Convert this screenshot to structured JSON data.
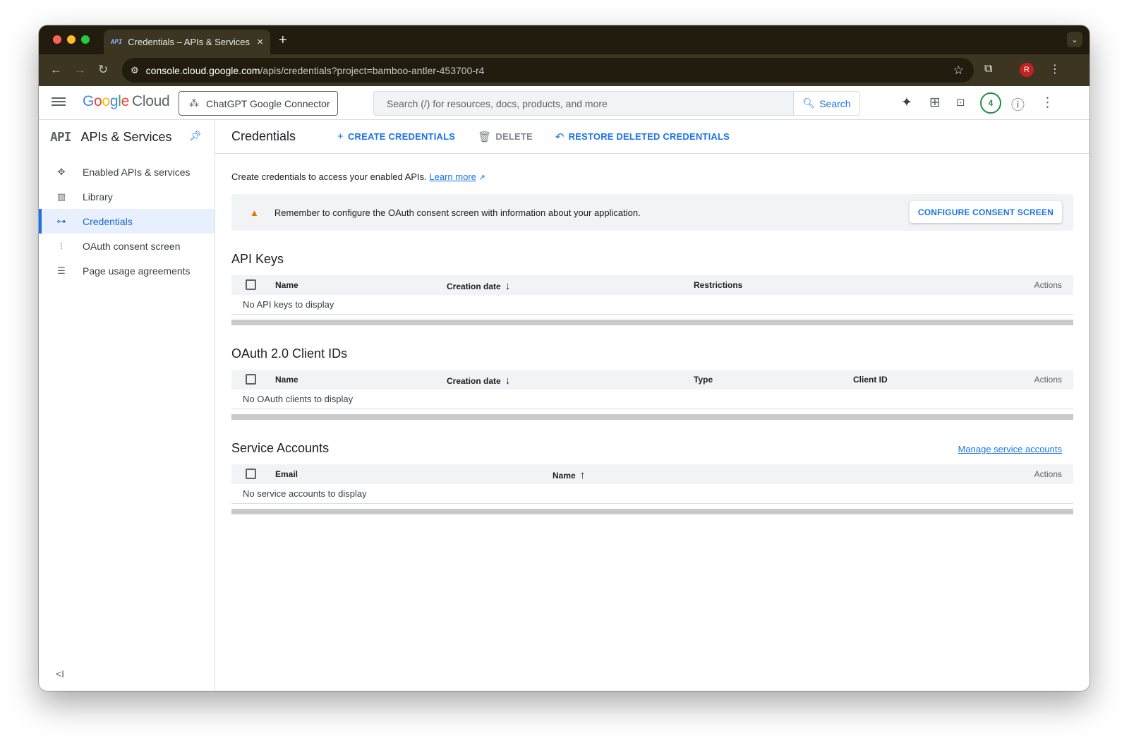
{
  "browser": {
    "tab_favicon": "API",
    "tab_title": "Credentials – APIs & Services",
    "tab_close": "×",
    "new_tab": "+",
    "url_host": "console.cloud.google.com",
    "url_path": "/apis/credentials?project=bamboo-antler-453700-r4",
    "profile_initial": "R"
  },
  "header": {
    "logo_google": [
      "G",
      "o",
      "o",
      "g",
      "l",
      "e"
    ],
    "logo_cloud": "Cloud",
    "project_name": "ChatGPT Google Connector",
    "search_placeholder": "Search (/) for resources, docs, products, and more",
    "search_button": "Search",
    "notification_count": "4"
  },
  "sidebar": {
    "logo": "API",
    "title": "APIs & Services",
    "items": [
      {
        "label": "Enabled APIs & services",
        "icon": "enabled-apis-icon"
      },
      {
        "label": "Library",
        "icon": "library-icon"
      },
      {
        "label": "Credentials",
        "icon": "key-icon",
        "active": true
      },
      {
        "label": "OAuth consent screen",
        "icon": "oauth-icon"
      },
      {
        "label": "Page usage agreements",
        "icon": "agreements-icon"
      }
    ],
    "collapse": "<I"
  },
  "main": {
    "title": "Credentials",
    "actions": {
      "create": "CREATE CREDENTIALS",
      "delete": "DELETE",
      "restore": "RESTORE DELETED CREDENTIALS"
    },
    "intro_text": "Create credentials to access your enabled APIs.",
    "learn_more": "Learn more",
    "banner_text": "Remember to configure the OAuth consent screen with information about your application.",
    "banner_button": "CONFIGURE CONSENT SCREEN",
    "api_keys": {
      "title": "API Keys",
      "columns": [
        "Name",
        "Creation date",
        "Restrictions",
        "Actions"
      ],
      "empty": "No API keys to display"
    },
    "oauth_clients": {
      "title": "OAuth 2.0 Client IDs",
      "columns": [
        "Name",
        "Creation date",
        "Type",
        "Client ID",
        "Actions"
      ],
      "empty": "No OAuth clients to display"
    },
    "service_accounts": {
      "title": "Service Accounts",
      "manage_link": "Manage service accounts",
      "columns": [
        "Email",
        "Name",
        "Actions"
      ],
      "empty": "No service accounts to display"
    }
  },
  "colors": {
    "accent": "#1a73e8",
    "active_bg": "#e8f0fe",
    "warning": "#e37400",
    "badge": "#1e8e3e"
  }
}
